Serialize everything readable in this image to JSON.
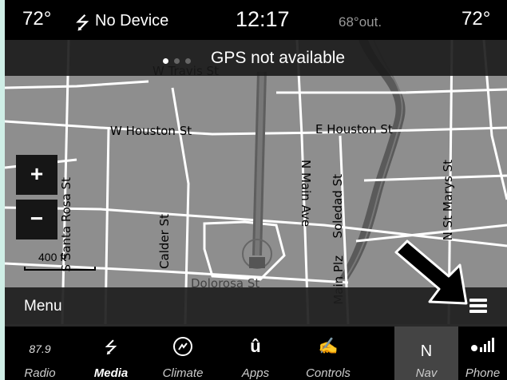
{
  "status": {
    "temp_left": "72°",
    "usb_icon": "usb-icon",
    "device": "No Device",
    "time": "12:17",
    "outside_temp": "68°out.",
    "temp_right": "72°"
  },
  "gps_banner": {
    "text": "GPS not available"
  },
  "map": {
    "streets": [
      "W Travis St",
      "W Houston St",
      "E Houston St",
      "N Main Ave",
      "Soledad St",
      "N St Marys St",
      "Calder St",
      "Dolorosa St",
      "S Santa Rosa St",
      "Main Plz"
    ],
    "zoom_in": "+",
    "zoom_out": "−",
    "scale": "400 ft"
  },
  "menu": {
    "label": "Menu"
  },
  "nav_bar": {
    "items": [
      {
        "label": "Radio",
        "icon": "87.9"
      },
      {
        "label": "Media",
        "icon": "usb-icon",
        "active": true
      },
      {
        "label": "Climate",
        "icon": "climate-icon"
      },
      {
        "label": "Apps",
        "icon": "uconnect-icon"
      },
      {
        "label": "Controls",
        "icon": "controls-icon"
      },
      {
        "label": "Nav",
        "icon": "N"
      },
      {
        "label": "Phone",
        "icon": "phone-signal-icon"
      }
    ]
  }
}
